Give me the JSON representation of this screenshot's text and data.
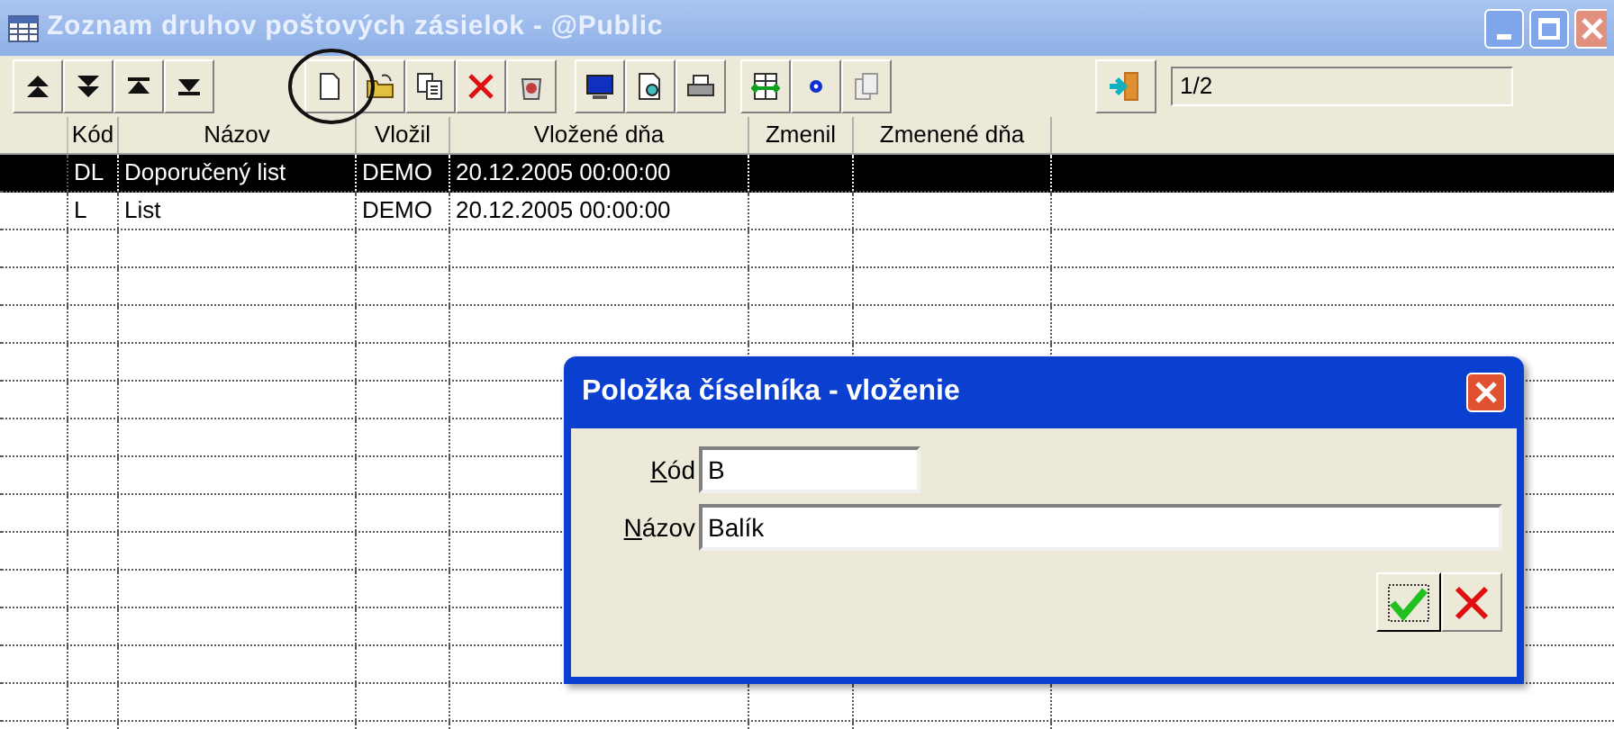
{
  "window": {
    "title": "Zoznam druhov poštových zásielok - @Public"
  },
  "record_position": "1/2",
  "table": {
    "columns": [
      "Kód",
      "Názov",
      "Vložil",
      "Vložené dňa",
      "Zmenil",
      "Zmenené dňa"
    ],
    "rows": [
      {
        "selected": true,
        "cells": [
          "DL",
          "Doporučený list",
          "DEMO",
          "20.12.2005 00:00:00",
          "",
          ""
        ]
      },
      {
        "selected": false,
        "cells": [
          "L",
          "List",
          "DEMO",
          "20.12.2005 00:00:00",
          "",
          ""
        ]
      }
    ]
  },
  "dialog": {
    "title": "Položka číselníka - vloženie",
    "fields": [
      {
        "label": "Kód",
        "value": "B",
        "kind": "short"
      },
      {
        "label": "Názov",
        "value": "Balík",
        "kind": "wide"
      }
    ]
  }
}
